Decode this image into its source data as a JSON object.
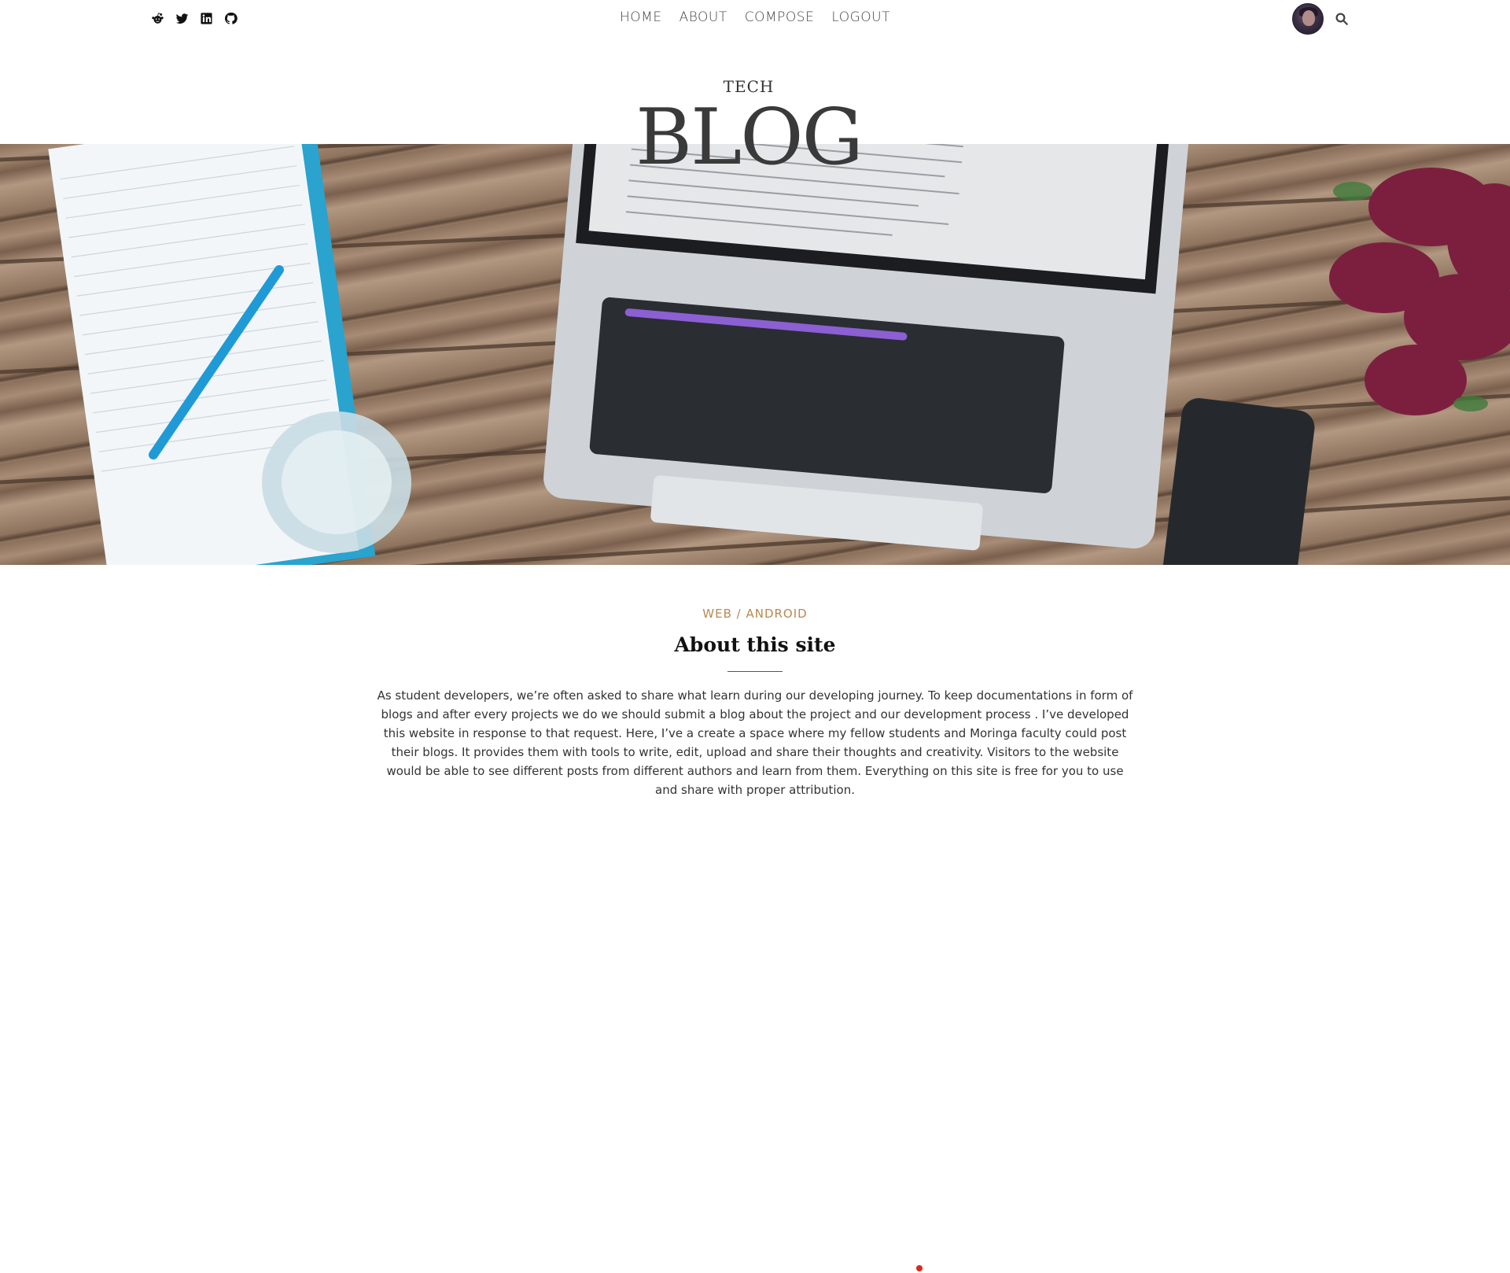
{
  "nav": {
    "items": [
      {
        "label": "HOME"
      },
      {
        "label": "ABOUT"
      },
      {
        "label": "COMPOSE"
      },
      {
        "label": "LOGOUT"
      }
    ]
  },
  "social_icons": [
    "reddit-icon",
    "twitter-icon",
    "linkedin-icon",
    "github-icon"
  ],
  "header": {
    "subtitle": "TECH",
    "title": "BLOG"
  },
  "hero": {
    "image_icon": "laptop-desk-photo"
  },
  "post": {
    "category": "WEB / ANDROID",
    "heading": "About this site",
    "body": "As student developers, we’re often asked to share what learn during our developing journey. To keep documentations in form of blogs and after every projects we do we should submit a blog about the project and our development process . I’ve developed this website in response to that request. Here, I’ve a create a space where my fellow students and Moringa faculty could post their blogs. It provides them with tools to write, edit, upload and share their thoughts and creativity. Visitors to the website would be able to see different posts from different authors and learn from them. Everything on this site is free for you to use and share with proper attribution."
  },
  "colors": {
    "accent": "#b8894f",
    "indicator": "#e0261f"
  }
}
